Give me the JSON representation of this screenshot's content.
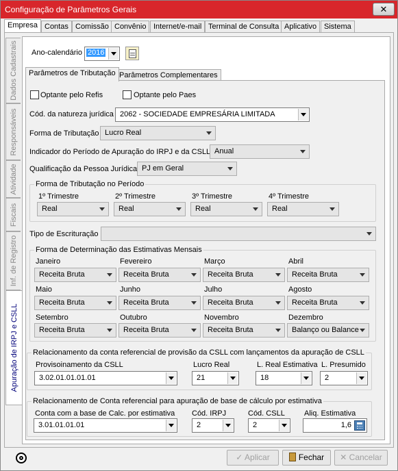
{
  "window": {
    "title": "Configuração de Parâmetros Gerais",
    "close_label": "✕"
  },
  "tabs": [
    "Empresa",
    "Contas",
    "Comissão",
    "Convênio",
    "Internet/e-mail",
    "Terminal de Consulta",
    "Aplicativo",
    "Sistema"
  ],
  "side_tabs": [
    "Dados Cadastrais",
    "Responsáveis",
    "Atividade",
    "Fiscais",
    "Inf. de Registro",
    "Apuração de IRPJ e CSLL"
  ],
  "ano": {
    "label": "Ano-calendário",
    "value": "2016"
  },
  "subtabs": [
    "Parâmetros de Tributação",
    "Parâmetros Complementares"
  ],
  "refis_label": "Optante pelo Refis",
  "paes_label": "Optante pelo Paes",
  "natureza": {
    "label": "Cód. da natureza jurídica",
    "value": "2062 - SOCIEDADE EMPRESÁRIA LIMITADA"
  },
  "forma": {
    "label": "Forma de Tributação",
    "value": "Lucro Real"
  },
  "indicador": {
    "label": "Indicador do Período de Apuração do IRPJ e da CSLL",
    "value": "Anual"
  },
  "qualificacao": {
    "label": "Qualificação da Pessoa Jurídica",
    "value": "PJ em Geral"
  },
  "periodo": {
    "title": "Forma de Tributação no Período",
    "items": [
      {
        "label": "1º Trimestre",
        "value": "Real"
      },
      {
        "label": "2º Trimestre",
        "value": "Real"
      },
      {
        "label": "3º Trimestre",
        "value": "Real"
      },
      {
        "label": "4º Trimestre",
        "value": "Real"
      }
    ]
  },
  "escrituracao": {
    "label": "Tipo de Escrituração",
    "value": ""
  },
  "estimativas": {
    "title": "Forma de Determinação das Estimativas Mensais",
    "months": [
      {
        "label": "Janeiro",
        "value": "Receita Bruta"
      },
      {
        "label": "Fevereiro",
        "value": "Receita Bruta"
      },
      {
        "label": "Março",
        "value": "Receita Bruta"
      },
      {
        "label": "Abril",
        "value": "Receita Bruta"
      },
      {
        "label": "Maio",
        "value": "Receita Bruta"
      },
      {
        "label": "Junho",
        "value": "Receita Bruta"
      },
      {
        "label": "Julho",
        "value": "Receita Bruta"
      },
      {
        "label": "Agosto",
        "value": "Receita Bruta"
      },
      {
        "label": "Setembro",
        "value": "Receita Bruta"
      },
      {
        "label": "Outubro",
        "value": "Receita Bruta"
      },
      {
        "label": "Novembro",
        "value": "Receita Bruta"
      },
      {
        "label": "Dezembro",
        "value": "Balanço ou Balance"
      }
    ]
  },
  "provisao": {
    "title": "Relacionamento da conta referencial de provisão da CSLL com lançamentos da apuração de CSLL",
    "prov_label": "Provisoinamento da CSLL",
    "prov_value": "3.02.01.01.01.01",
    "lucro_label": "Lucro Real",
    "lucro_value": "21",
    "lre_label": "L. Real Estimativa",
    "lre_value": "18",
    "lp_label": "L. Presumido",
    "lp_value": "2"
  },
  "estimativa": {
    "title": "Relacionamento de Conta referencial para apuração de base de cálculo por estimativa",
    "conta_label": "Conta com a base de Calc. por estimativa",
    "conta_value": "3.01.01.01.01",
    "irpj_label": "Cód. IRPJ",
    "irpj_value": "2",
    "csll_label": "Cód. CSLL",
    "csll_value": "2",
    "aliq_label": "Aliq. Estimativa",
    "aliq_value": "1,6"
  },
  "buttons": {
    "aplicar": "Aplicar",
    "fechar": "Fechar",
    "cancelar": "Cancelar"
  }
}
